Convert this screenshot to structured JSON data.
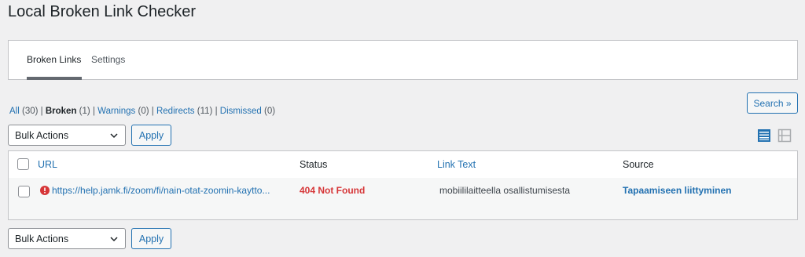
{
  "page": {
    "title": "Local Broken Link Checker"
  },
  "tabs": [
    {
      "label": "Broken Links",
      "active": true
    },
    {
      "label": "Settings",
      "active": false
    }
  ],
  "filters": [
    {
      "label": "All",
      "count": "(30)",
      "current": false
    },
    {
      "label": "Broken",
      "count": "(1)",
      "current": true
    },
    {
      "label": "Warnings",
      "count": "(0)",
      "current": false
    },
    {
      "label": "Redirects",
      "count": "(11)",
      "current": false
    },
    {
      "label": "Dismissed",
      "count": "(0)",
      "current": false
    }
  ],
  "search": {
    "button_label": "Search »"
  },
  "bulk_top": {
    "selected": "Bulk Actions",
    "apply_label": "Apply"
  },
  "bulk_bottom": {
    "selected": "Bulk Actions",
    "apply_label": "Apply"
  },
  "view_modes": {
    "icons": [
      "list-view-icon",
      "excerpt-view-icon"
    ],
    "active": "list-view-icon"
  },
  "table": {
    "headers": {
      "url": "URL",
      "status": "Status",
      "link_text": "Link Text",
      "source": "Source"
    },
    "rows": [
      {
        "url": "https://help.jamk.fi/zoom/fi/nain-otat-zoomin-kaytto...",
        "status": "404 Not Found",
        "link_text": "mobiililaitteella osallistumisesta",
        "source": "Tapaamiseen liittyminen"
      }
    ]
  },
  "colors": {
    "accent": "#2271b1",
    "error": "#d63638",
    "background": "#f0f0f1"
  }
}
